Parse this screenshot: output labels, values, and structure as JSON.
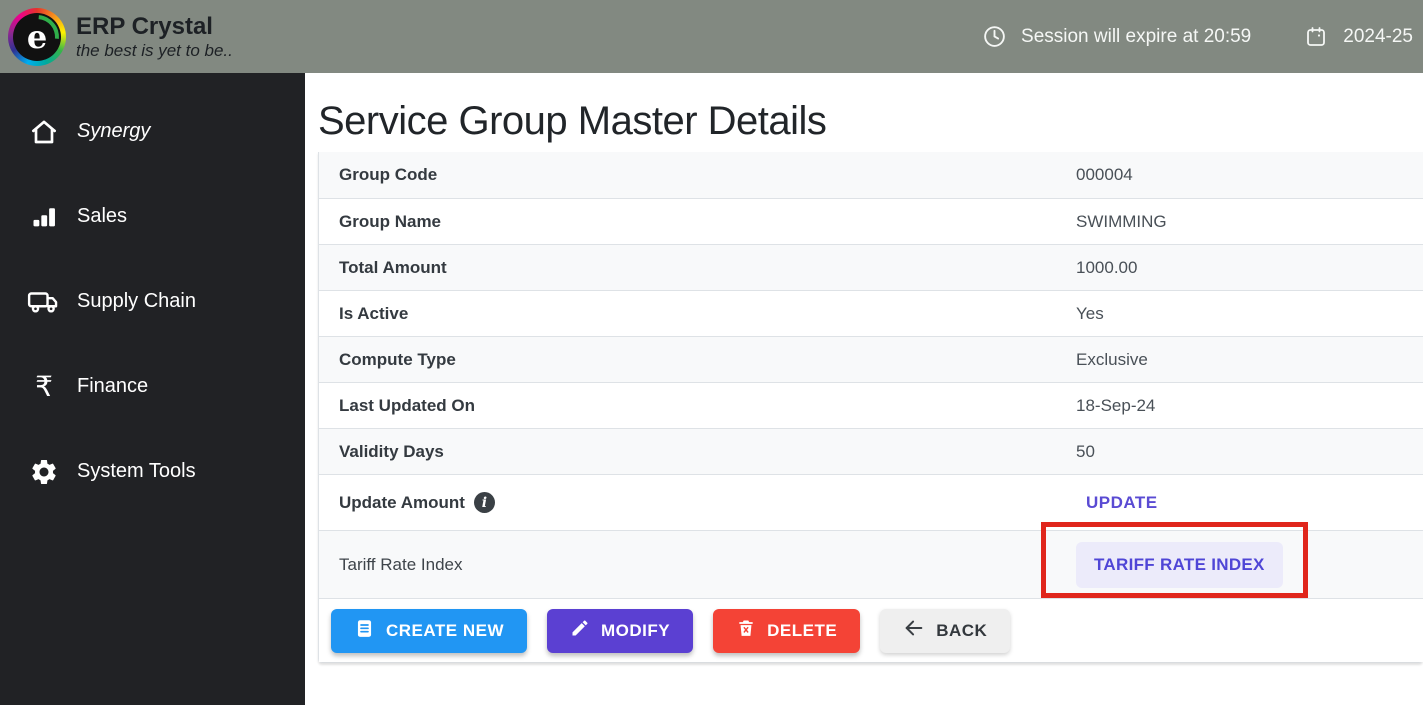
{
  "header": {
    "brand_title": "ERP Crystal",
    "brand_tagline": "the best is yet to be..",
    "session_text": "Session will expire at 20:59",
    "fiscal_year": "2024-25"
  },
  "sidebar": {
    "items": [
      {
        "label": "Synergy",
        "icon": "home-icon"
      },
      {
        "label": "Sales",
        "icon": "bar-chart-icon"
      },
      {
        "label": "Supply Chain",
        "icon": "truck-icon"
      },
      {
        "label": "Finance",
        "icon": "rupee-icon"
      },
      {
        "label": "System Tools",
        "icon": "gear-icon"
      }
    ]
  },
  "main": {
    "page_title": "Service Group Master Details",
    "details": [
      {
        "label": "Group Code",
        "value": "000004"
      },
      {
        "label": "Group Name",
        "value": "SWIMMING"
      },
      {
        "label": "Total Amount",
        "value": "1000.00"
      },
      {
        "label": "Is Active",
        "value": "Yes"
      },
      {
        "label": "Compute Type",
        "value": "Exclusive"
      },
      {
        "label": "Last Updated On",
        "value": "18-Sep-24"
      },
      {
        "label": "Validity Days",
        "value": "50"
      },
      {
        "label": "Update Amount",
        "value": "UPDATE"
      },
      {
        "label": "Tariff Rate Index",
        "value": "TARIFF RATE INDEX"
      }
    ],
    "actions": {
      "create_new": "CREATE NEW",
      "modify": "MODIFY",
      "delete": "DELETE",
      "back": "BACK"
    }
  },
  "icons": {
    "rupee_glyph": "₹"
  },
  "colors": {
    "header_bg": "#828981",
    "sidebar_bg": "#212225",
    "row_stripe": "#f8f9fa",
    "row_border": "#dee2e6",
    "update_link": "#5a4bd3",
    "tariff_button_bg": "#ecebfa",
    "tariff_button_text": "#4f46d6",
    "create_new_bg": "#2196f3",
    "modify_bg": "#5b40d2",
    "delete_bg": "#f44336",
    "back_bg": "#efefef",
    "annotation_red": "#e0261c"
  }
}
